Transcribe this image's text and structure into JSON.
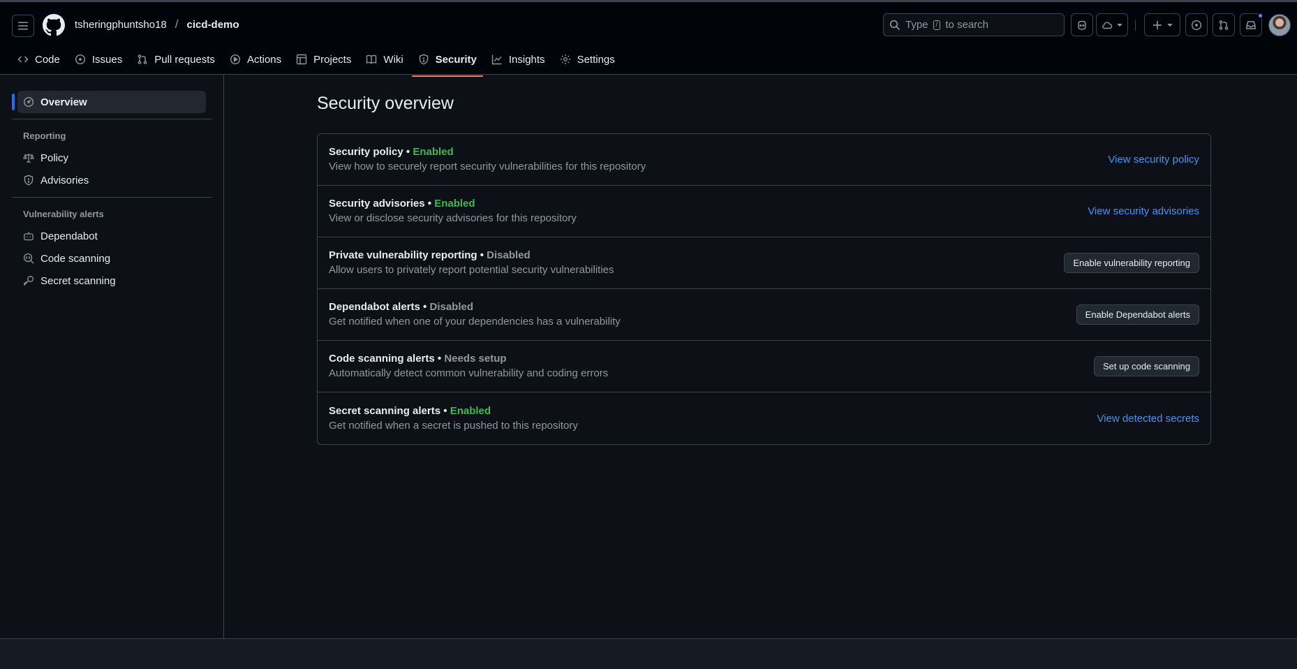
{
  "header": {
    "owner": "tsheringphuntsho18",
    "separator": "/",
    "repo": "cicd-demo",
    "search_placeholder_pre": "Type",
    "search_key": "/",
    "search_placeholder_post": "to search"
  },
  "nav": {
    "tabs": [
      {
        "label": "Code",
        "icon": "code-icon"
      },
      {
        "label": "Issues",
        "icon": "issue-opened-icon"
      },
      {
        "label": "Pull requests",
        "icon": "git-pull-request-icon"
      },
      {
        "label": "Actions",
        "icon": "play-icon"
      },
      {
        "label": "Projects",
        "icon": "table-icon"
      },
      {
        "label": "Wiki",
        "icon": "book-icon"
      },
      {
        "label": "Security",
        "icon": "shield-icon",
        "active": true
      },
      {
        "label": "Insights",
        "icon": "graph-icon"
      },
      {
        "label": "Settings",
        "icon": "gear-icon"
      }
    ]
  },
  "sidebar": {
    "overview": "Overview",
    "reporting_heading": "Reporting",
    "reporting_items": [
      "Policy",
      "Advisories"
    ],
    "vuln_heading": "Vulnerability alerts",
    "vuln_items": [
      "Dependabot",
      "Code scanning",
      "Secret scanning"
    ]
  },
  "main": {
    "title": "Security overview",
    "rows": [
      {
        "title": "Security policy",
        "bullet": "•",
        "status": "Enabled",
        "desc": "View how to securely report security vulnerabilities for this repository",
        "action": "View security policy"
      },
      {
        "title": "Security advisories",
        "bullet": "•",
        "status": "Enabled",
        "desc": "View or disclose security advisories for this repository",
        "action": "View security advisories"
      },
      {
        "title": "Private vulnerability reporting",
        "bullet": "•",
        "status": "Disabled",
        "desc": "Allow users to privately report potential security vulnerabilities",
        "action": "Enable vulnerability reporting"
      },
      {
        "title": "Dependabot alerts",
        "bullet": "•",
        "status": "Disabled",
        "desc": "Get notified when one of your dependencies has a vulnerability",
        "action": "Enable Dependabot alerts"
      },
      {
        "title": "Code scanning alerts",
        "bullet": "•",
        "status": "Needs setup",
        "desc": "Automatically detect common vulnerability and coding errors",
        "action": "Set up code scanning"
      },
      {
        "title": "Secret scanning alerts",
        "bullet": "•",
        "status": "Enabled",
        "desc": "Get notified when a secret is pushed to this repository",
        "action": "View detected secrets"
      }
    ]
  },
  "colors": {
    "background": "#0d1117",
    "header_bg": "#010409",
    "accent_tab": "#f78166",
    "enabled": "#3fb950",
    "link": "#4493f8"
  }
}
